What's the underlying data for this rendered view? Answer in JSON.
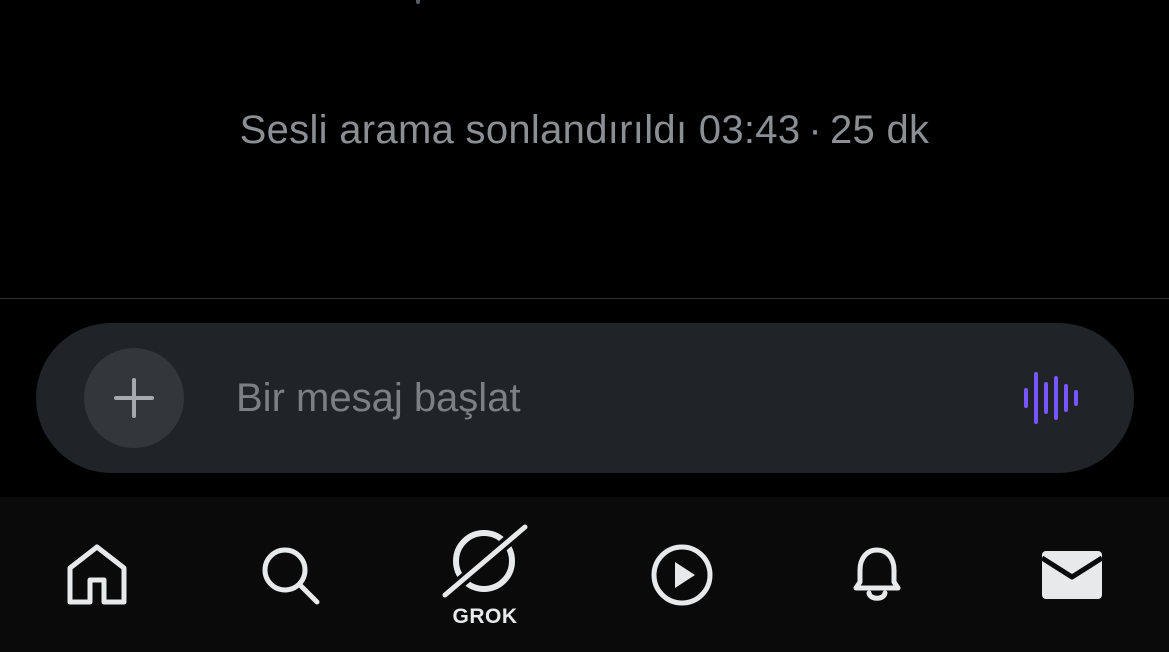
{
  "conversation": {
    "call_status_text": "Sesli arama sonlandırıldı 03:43",
    "separator": "·",
    "time_ago": "25 dk"
  },
  "composer": {
    "placeholder": "Bir mesaj başlat",
    "add_icon": "plus-icon",
    "voice_icon": "audio-waveform-icon",
    "voice_color": "#7856ff"
  },
  "bottom_nav": {
    "items": [
      {
        "icon": "home-icon"
      },
      {
        "icon": "search-icon"
      },
      {
        "icon": "grok-icon",
        "label": "GROK"
      },
      {
        "icon": "play-icon"
      },
      {
        "icon": "bell-icon"
      },
      {
        "icon": "mail-icon"
      }
    ]
  },
  "colors": {
    "background": "#000000",
    "composer_bg": "#202327",
    "add_button_bg": "#33363a",
    "nav_bg": "#0a0a0a",
    "muted_text": "#8b8f94"
  }
}
